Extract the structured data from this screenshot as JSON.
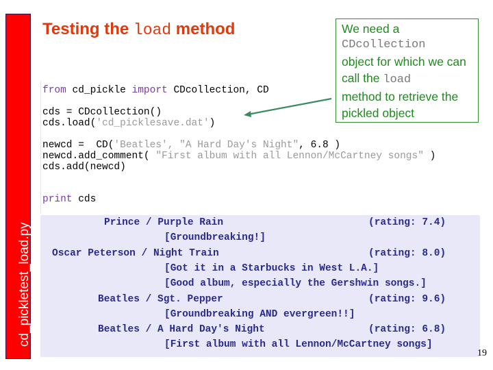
{
  "sidebar": {
    "filename": "cd_pickletest_load.py",
    "color": "#ff0000"
  },
  "title": {
    "prefix": "Testing the ",
    "code": "load",
    "suffix": " method",
    "color": "#e03a0c"
  },
  "callout": {
    "text1": "We need a",
    "code1": "CDcollection",
    "text2": "object for which we can call the",
    "code2": "load",
    "text3": "method to retrieve the pickled object",
    "color": "#1f8a1f"
  },
  "code": {
    "line1": {
      "kw1": "from",
      "t1": " cd_pickle ",
      "kw2": "import",
      "t2": " CDcollection, CD"
    },
    "line2": "cds = CDcollection()",
    "line3": {
      "t1": "cds.load(",
      "s1": "'cd_picklesave.dat'",
      "t2": ")"
    },
    "line4": {
      "t1": "newcd =  CD(",
      "s1": "'Beatles', \"A Hard Day's Night\"",
      "t2": ", 6.8 )"
    },
    "line5": {
      "t1": "newcd.add_comment( ",
      "s1": "\"First album with all Lennon/McCartney songs\"",
      "t2": " )"
    },
    "line6": "cds.add(newcd)",
    "line7": {
      "kw1": "print",
      "t1": " cds"
    }
  },
  "output": {
    "lines": [
      "Prince / Purple Rain                    (rating: 7.4)",
      "[Groundbreaking!]",
      "Oscar Peterson / Night Train                    (rating: 8.0)",
      "[Got it in a Starbucks in West L.A.]",
      "[Good album, especially the Gershwin songs.]",
      "Beatles / Sgt. Pepper                    (rating: 9.6)",
      "[Groundbreaking AND evergreen!!]",
      "Beatles / A Hard Day's Night                    (rating: 6.8)",
      "[First album with all Lennon/McCartney songs]"
    ],
    "records": [
      {
        "artist": "Prince",
        "title": "Purple Rain",
        "rating": "(rating: 7.4)",
        "comments": [
          "[Groundbreaking!]"
        ]
      },
      {
        "artist": "Oscar Peterson",
        "title": "Night Train",
        "rating": "(rating: 8.0)",
        "comments": [
          "[Got it in a Starbucks in West L.A.]",
          "[Good album, especially the Gershwin songs.]"
        ]
      },
      {
        "artist": "Beatles",
        "title": "Sgt. Pepper",
        "rating": "(rating: 9.6)",
        "comments": [
          "[Groundbreaking AND evergreen!!]"
        ]
      },
      {
        "artist": "Beatles",
        "title": "A Hard Day's Night",
        "rating": "(rating: 6.8)",
        "comments": [
          "[First album with all Lennon/McCartney songs]"
        ]
      }
    ],
    "background": "#e8e8f8",
    "text_color": "#2a2a8e"
  },
  "page_number": "19"
}
